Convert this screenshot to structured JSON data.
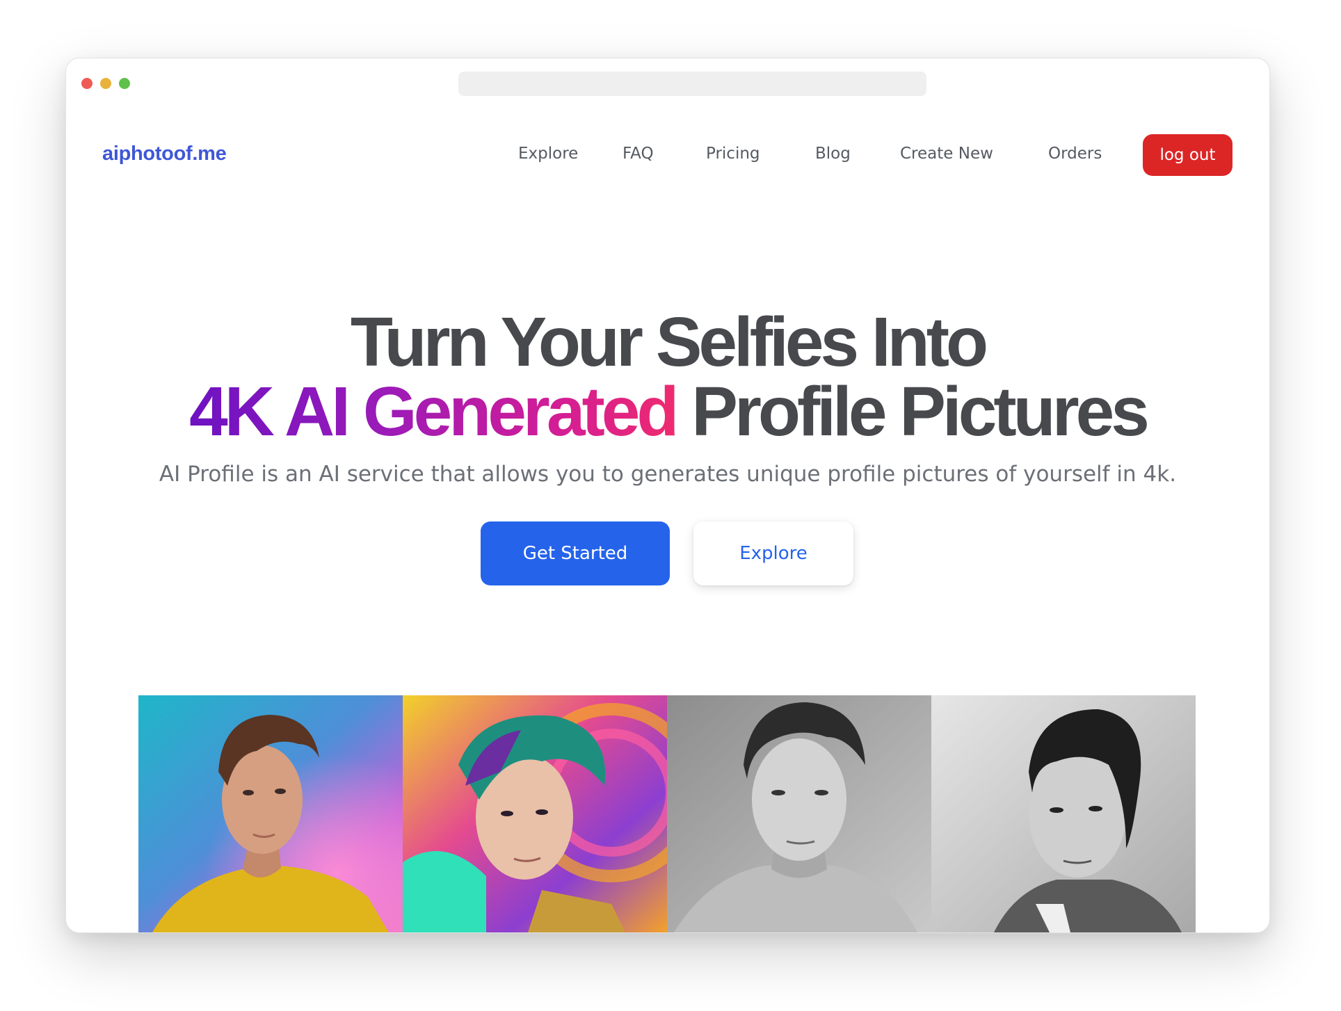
{
  "browser": {
    "url": ""
  },
  "nav": {
    "logo": "aiphotoof.me",
    "links": [
      {
        "label": "Explore"
      },
      {
        "label": "FAQ"
      },
      {
        "label": "Pricing"
      },
      {
        "label": "Blog"
      },
      {
        "label": "Create New"
      },
      {
        "label": "Orders"
      }
    ],
    "logout_label": "log out",
    "logout_color": "#dc2626"
  },
  "hero": {
    "line1": "Turn Your Selfies Into",
    "line2_gradient": "4K AI Generated",
    "line2_rest": " Profile Pictures",
    "subtitle": "AI Profile is an AI service that allows you to generates unique profile pictures of yourself in 4k.",
    "primary_button": "Get Started",
    "secondary_button": "Explore",
    "accent": "#2563eb"
  },
  "gallery": {
    "images": [
      {
        "name": "portrait-color-photo"
      },
      {
        "name": "portrait-colorful-illustration"
      },
      {
        "name": "portrait-pencil-sketch"
      },
      {
        "name": "portrait-charcoal-drawing"
      }
    ]
  }
}
